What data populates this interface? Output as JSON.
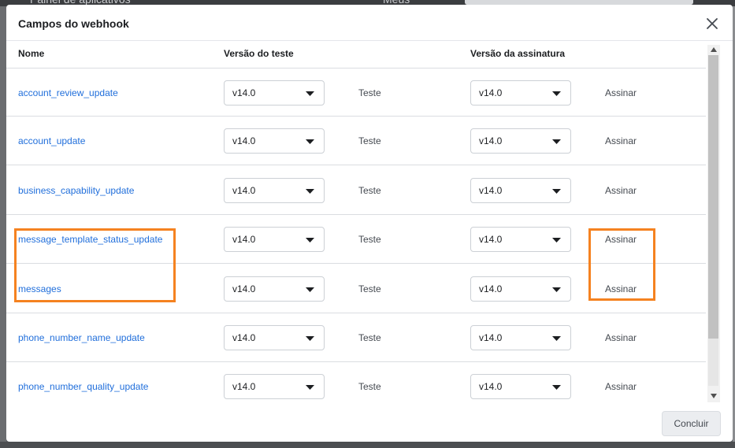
{
  "modal": {
    "title": "Campos do webhook",
    "close_icon": "close-icon"
  },
  "table": {
    "headers": {
      "name": "Nome",
      "test_version": "Versão do teste",
      "subscription_version": "Versão da assinatura"
    },
    "rows": [
      {
        "name": "account_review_update",
        "test_version": "v14.0",
        "test_action": "Teste",
        "subscription_version": "v14.0",
        "subscribe_action": "Assinar"
      },
      {
        "name": "account_update",
        "test_version": "v14.0",
        "test_action": "Teste",
        "subscription_version": "v14.0",
        "subscribe_action": "Assinar"
      },
      {
        "name": "business_capability_update",
        "test_version": "v14.0",
        "test_action": "Teste",
        "subscription_version": "v14.0",
        "subscribe_action": "Assinar"
      },
      {
        "name": "message_template_status_update",
        "test_version": "v14.0",
        "test_action": "Teste",
        "subscription_version": "v14.0",
        "subscribe_action": "Assinar"
      },
      {
        "name": "messages",
        "test_version": "v14.0",
        "test_action": "Teste",
        "subscription_version": "v14.0",
        "subscribe_action": "Assinar"
      },
      {
        "name": "phone_number_name_update",
        "test_version": "v14.0",
        "test_action": "Teste",
        "subscription_version": "v14.0",
        "subscribe_action": "Assinar"
      },
      {
        "name": "phone_number_quality_update",
        "test_version": "v14.0",
        "test_action": "Teste",
        "subscription_version": "v14.0",
        "subscribe_action": "Assinar"
      }
    ]
  },
  "footer": {
    "done_label": "Concluir"
  },
  "colors": {
    "link": "#216fdb",
    "highlight": "#f58220"
  }
}
